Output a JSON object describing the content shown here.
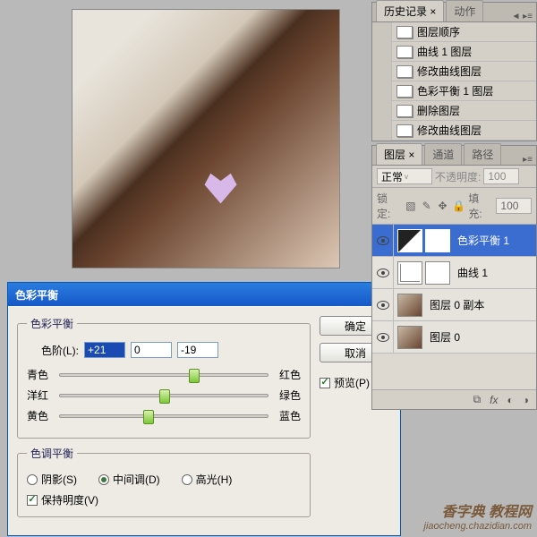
{
  "dialog": {
    "title": "色彩平衡",
    "group1": "色彩平衡",
    "levels_label": "色阶(L):",
    "level1": "+21",
    "level2": "0",
    "level3": "-19",
    "sliders": [
      {
        "left": "青色",
        "right": "红色",
        "pos": 62
      },
      {
        "left": "洋红",
        "right": "绿色",
        "pos": 48
      },
      {
        "left": "黄色",
        "right": "蓝色",
        "pos": 40
      }
    ],
    "group2": "色调平衡",
    "shadows": "阴影(S)",
    "midtones": "中间调(D)",
    "highlights": "高光(H)",
    "preserve": "保持明度(V)",
    "ok": "确定",
    "cancel": "取消",
    "preview": "预览(P)"
  },
  "history": {
    "tab1": "历史记录",
    "tab2": "动作",
    "items": [
      "图层顺序",
      "曲线 1 图层",
      "修改曲线图层",
      "色彩平衡 1 图层",
      "删除图层",
      "修改曲线图层"
    ]
  },
  "layers": {
    "tab1": "图层",
    "tab2": "通道",
    "tab3": "路径",
    "blend": "正常",
    "opacity_label": "不透明度:",
    "opacity_val": "100",
    "lock_label": "锁定:",
    "fill_label": "填充:",
    "fill_val": "100",
    "items": [
      {
        "name": "色彩平衡 1",
        "type": "adj-diag",
        "sel": true
      },
      {
        "name": "曲线 1",
        "type": "adj-curve"
      },
      {
        "name": "图层 0 副本",
        "type": "photo"
      },
      {
        "name": "图层 0",
        "type": "photo"
      }
    ]
  },
  "watermark": {
    "l1": "香字典 教程网",
    "l2": "jiaocheng.chazidian.com"
  }
}
